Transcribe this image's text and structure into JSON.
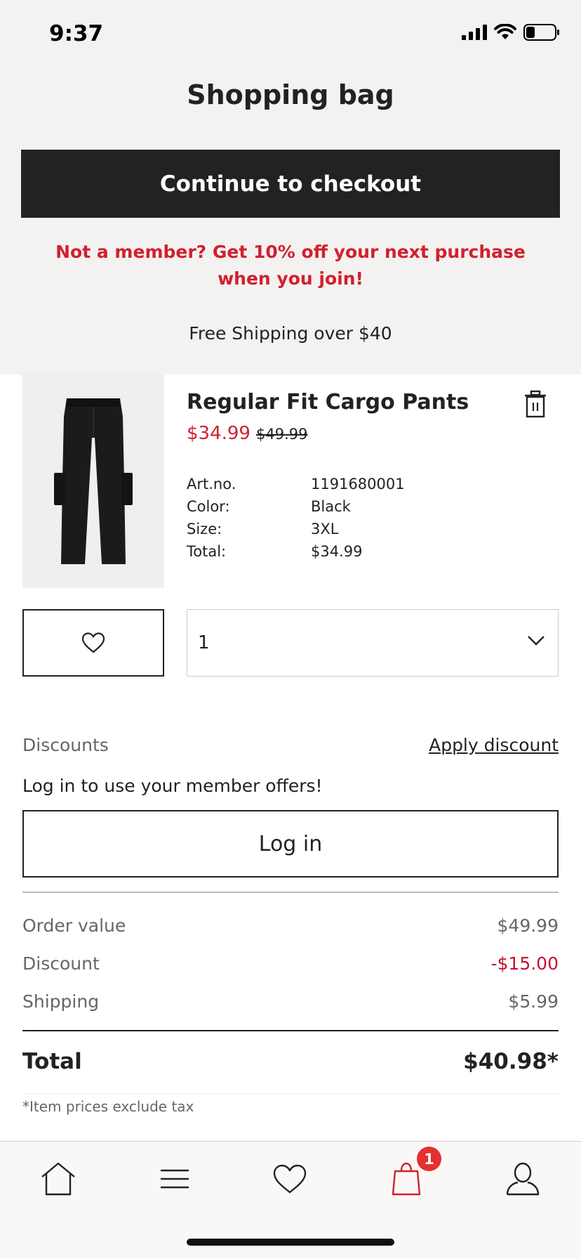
{
  "status_bar": {
    "time": "9:37"
  },
  "header": {
    "title": "Shopping bag"
  },
  "checkout": {
    "label": "Continue to checkout"
  },
  "promo": {
    "member_text": "Not a member? Get 10% off your next purchase when you join!"
  },
  "shipping_banner": {
    "text": "Free Shipping over $40"
  },
  "product": {
    "name": "Regular Fit Cargo Pants",
    "sale_price": "$34.99",
    "original_price": "$49.99",
    "details": [
      {
        "label": "Art.no.",
        "value": "1191680001"
      },
      {
        "label": "Color:",
        "value": "Black"
      },
      {
        "label": "Size:",
        "value": "3XL"
      },
      {
        "label": "Total:",
        "value": "$34.99"
      }
    ],
    "quantity": "1"
  },
  "discounts": {
    "label": "Discounts",
    "apply_link": "Apply discount",
    "member_offers": "Log in to use your member offers!",
    "login_label": "Log in"
  },
  "summary": {
    "rows": [
      {
        "label": "Order value",
        "value": "$49.99"
      },
      {
        "label": "Discount",
        "value": "-$15.00"
      },
      {
        "label": "Shipping",
        "value": "$5.99"
      }
    ],
    "total_label": "Total",
    "total_value": "$40.98*",
    "tax_note": "*Item prices exclude tax"
  },
  "nav": {
    "items": [
      "home-icon",
      "menu-icon",
      "heart-icon",
      "bag-icon",
      "account-icon"
    ],
    "bag_badge": "1"
  },
  "colors": {
    "accent_red": "#d1202e",
    "button_dark": "#222222",
    "background": "#f4f2f0"
  }
}
